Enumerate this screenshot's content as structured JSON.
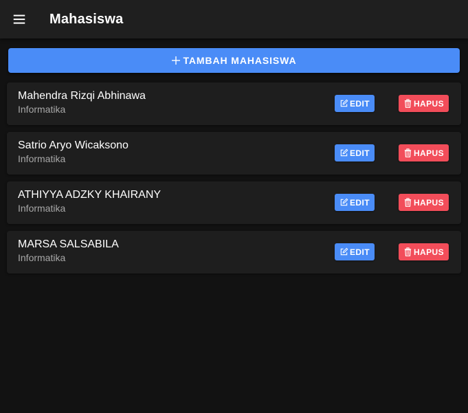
{
  "toolbar": {
    "menu_icon": "menu-icon",
    "title": "Mahasiswa"
  },
  "add_button": {
    "icon": "plus-icon",
    "label": "TAMBAH MAHASISWA"
  },
  "students": [
    {
      "name": "Mahendra Rizqi Abhinawa",
      "major": "Informatika"
    },
    {
      "name": "Satrio Aryo Wicaksono",
      "major": "Informatika"
    },
    {
      "name": "ATHIYYA ADZKY KHAIRANY",
      "major": "Informatika"
    },
    {
      "name": "MARSA SALSABILA",
      "major": "Informatika"
    }
  ],
  "actions": {
    "edit_label": "EDIT",
    "edit_icon": "edit-icon",
    "delete_label": "HAPUS",
    "delete_icon": "trash-icon"
  },
  "colors": {
    "background": "#121212",
    "toolbar": "#1f1f1f",
    "card": "#1e1e1e",
    "primary": "#4a8cf7",
    "danger": "#f24d5a",
    "secondary_text": "#a8a8a8"
  }
}
